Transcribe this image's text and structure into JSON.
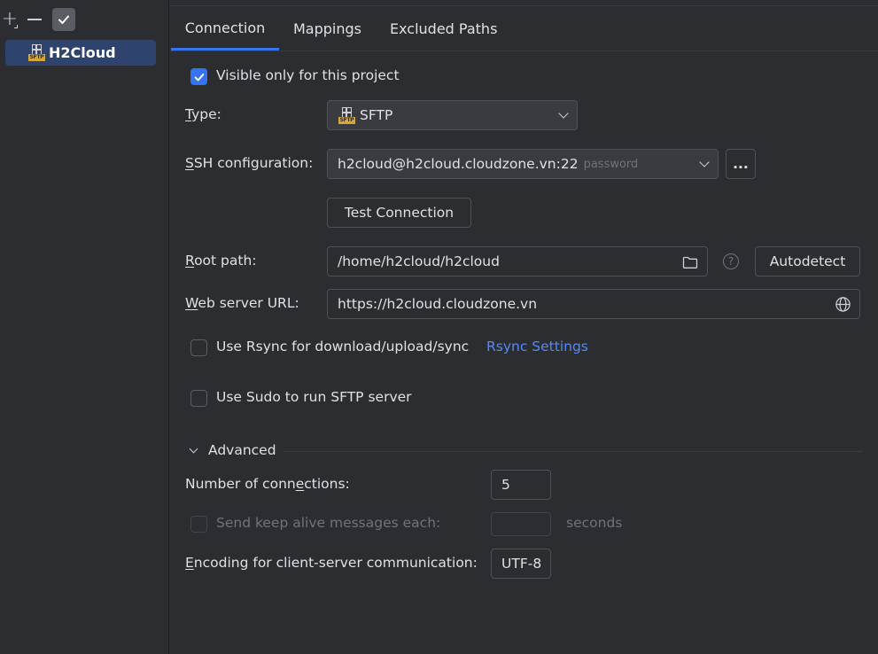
{
  "toolbar": {
    "add_label": "+",
    "add_icon": "plus-icon",
    "remove_icon": "minus-icon",
    "apply_icon": "check-icon"
  },
  "servers": [
    {
      "name": "H2Cloud",
      "icon": "sftp-icon",
      "icon_text": "SFTP"
    }
  ],
  "tabs": [
    {
      "label": "Connection",
      "active": true
    },
    {
      "label": "Mappings",
      "active": false
    },
    {
      "label": "Excluded Paths",
      "active": false
    }
  ],
  "form": {
    "visible_only": {
      "label": "Visible only for this project",
      "checked": true
    },
    "type": {
      "label_key": "T",
      "label_rest": "ype:",
      "value": "SFTP",
      "icon_text": "SFTP"
    },
    "ssh": {
      "label_key": "S",
      "label_rest": "SH configuration:",
      "value": "h2cloud@h2cloud.cloudzone.vn:22",
      "hint": "password",
      "browse_label": "..."
    },
    "test_connection_label": "Test Connection",
    "root_path": {
      "label_key": "R",
      "label_rest": "oot path:",
      "value": "/home/h2cloud/h2cloud",
      "autodetect_label": "Autodetect",
      "help_label": "?"
    },
    "web_url": {
      "label_key": "W",
      "label_rest": "eb server URL:",
      "value": "https://h2cloud.cloudzone.vn"
    },
    "rsync": {
      "label": "Use Rsync for download/upload/sync",
      "checked": false,
      "settings_link": "Rsync Settings"
    },
    "sudo": {
      "label": "Use Sudo to run SFTP server",
      "checked": false
    }
  },
  "advanced": {
    "title": "Advanced",
    "connections": {
      "label_pre": "Number of conn",
      "label_key": "e",
      "label_post": "ctions:",
      "value": "5"
    },
    "keep_alive": {
      "label": "Send keep alive messages each:",
      "value": "",
      "unit": "seconds",
      "enabled": false
    },
    "encoding": {
      "label_key": "E",
      "label_rest": "ncoding for client-server communication:",
      "value": "UTF-8"
    }
  },
  "colors": {
    "accent": "#3574f0",
    "link": "#548af7",
    "selection": "#2e436e",
    "background": "#2b2d30"
  }
}
